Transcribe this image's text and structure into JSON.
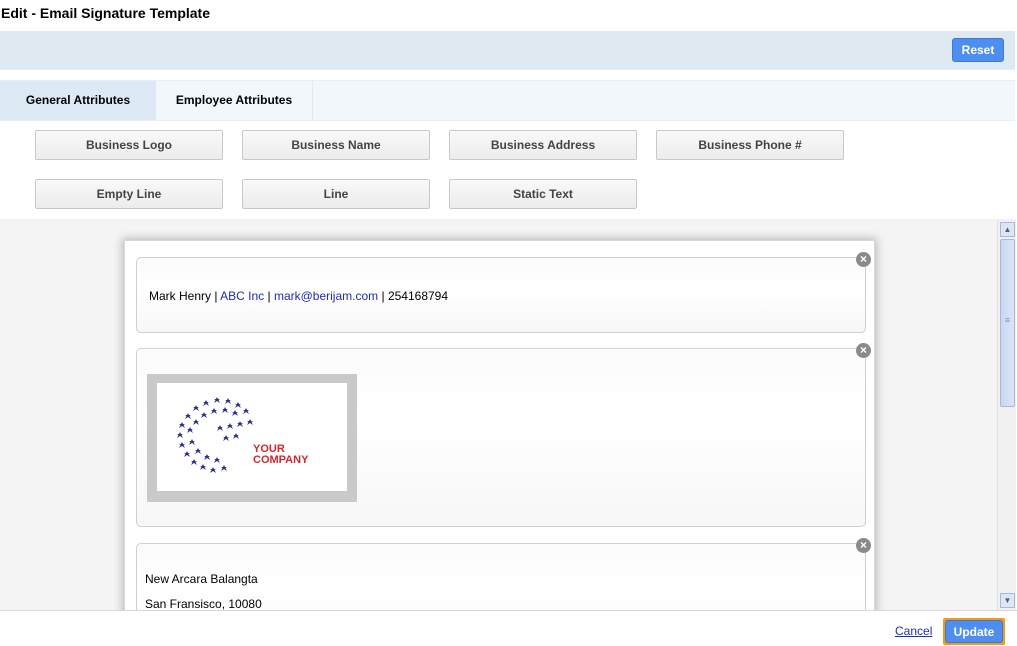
{
  "window": {
    "title": "Edit - Email Signature Template"
  },
  "toolbar": {
    "reset_label": "Reset"
  },
  "tabs": [
    {
      "label": "General Attributes"
    },
    {
      "label": "Employee Attributes"
    }
  ],
  "attributes": [
    {
      "label": "Business Logo"
    },
    {
      "label": "Business Name"
    },
    {
      "label": "Business Address"
    },
    {
      "label": "Business Phone #"
    },
    {
      "label": "Empty Line"
    },
    {
      "label": "Line"
    },
    {
      "label": "Static Text"
    }
  ],
  "signature": {
    "name_line": {
      "name": "Mark Henry",
      "sep1": " | ",
      "company": "ABC Inc",
      "sep2": " | ",
      "email": "mark@berijam.com",
      "sep3": " | ",
      "phone": "254168794"
    },
    "logo": {
      "line1": "YOUR",
      "line2": "COMPANY",
      "color_text": "#d0282e",
      "color_globe": "#2a2f8a"
    },
    "address": {
      "line1": "New Arcara Balangta",
      "line2": "San Fransisco, 10080"
    },
    "close_glyph": "×"
  },
  "scrollbar": {
    "up_icon": "▲",
    "down_icon": "▼",
    "grip": "≡"
  },
  "footer": {
    "cancel_label": "Cancel",
    "update_label": "Update"
  }
}
